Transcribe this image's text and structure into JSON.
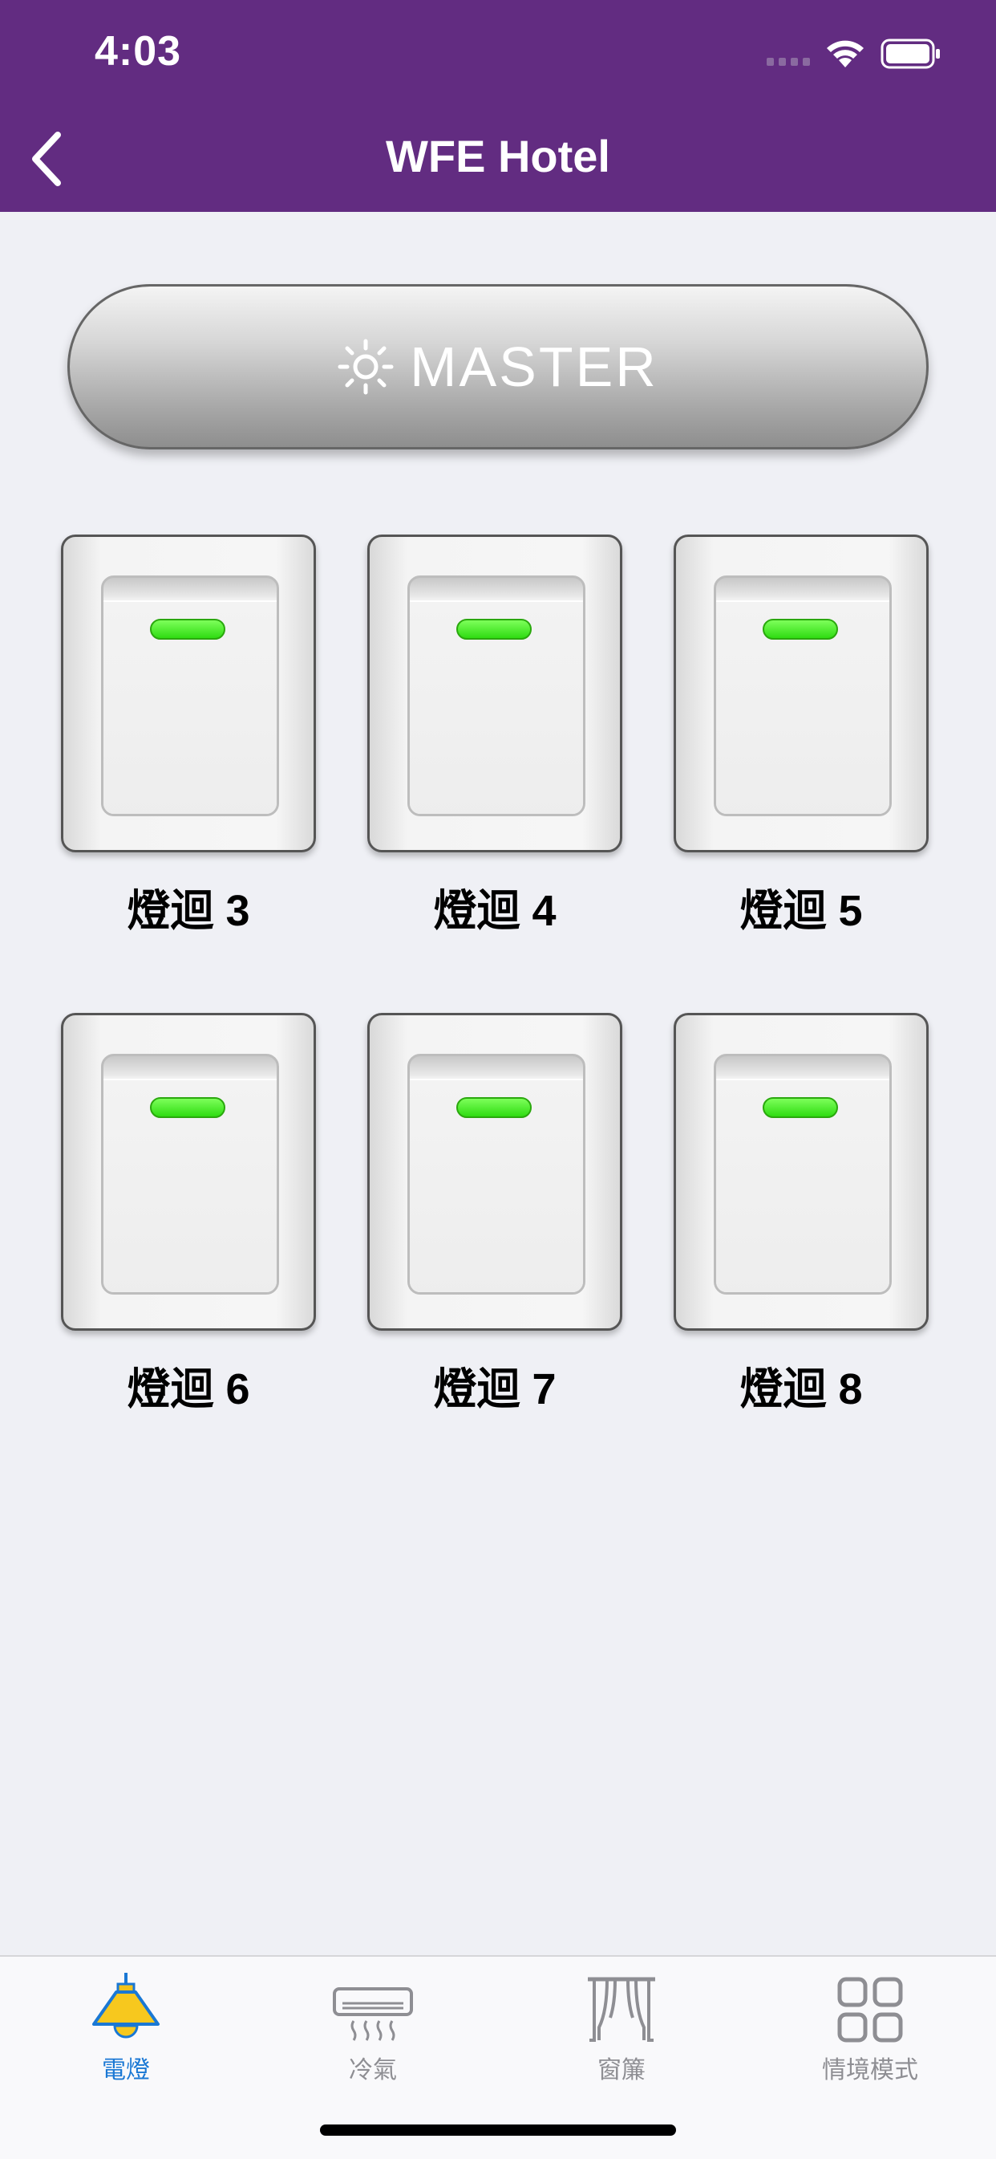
{
  "status_bar": {
    "time": "4:03"
  },
  "header": {
    "title": "WFE Hotel",
    "back_icon": "chevron-left-icon"
  },
  "master": {
    "label": "MASTER",
    "icon": "sun-icon"
  },
  "switches": [
    {
      "label": "燈迴 3",
      "led": "on"
    },
    {
      "label": "燈迴 4",
      "led": "on"
    },
    {
      "label": "燈迴 5",
      "led": "on"
    },
    {
      "label": "燈迴 6",
      "led": "on"
    },
    {
      "label": "燈迴 7",
      "led": "on"
    },
    {
      "label": "燈迴 8",
      "led": "on"
    }
  ],
  "tabs": [
    {
      "label": "電燈",
      "icon": "lamp-icon",
      "active": true
    },
    {
      "label": "冷氣",
      "icon": "air-conditioner-icon",
      "active": false
    },
    {
      "label": "窗簾",
      "icon": "curtain-icon",
      "active": false
    },
    {
      "label": "情境模式",
      "icon": "grid-icon",
      "active": false
    }
  ],
  "colors": {
    "header_bg": "#622c81",
    "led_green": "#3ee01c",
    "tab_active": "#1a78d4",
    "tab_inactive": "#8e8e93"
  }
}
